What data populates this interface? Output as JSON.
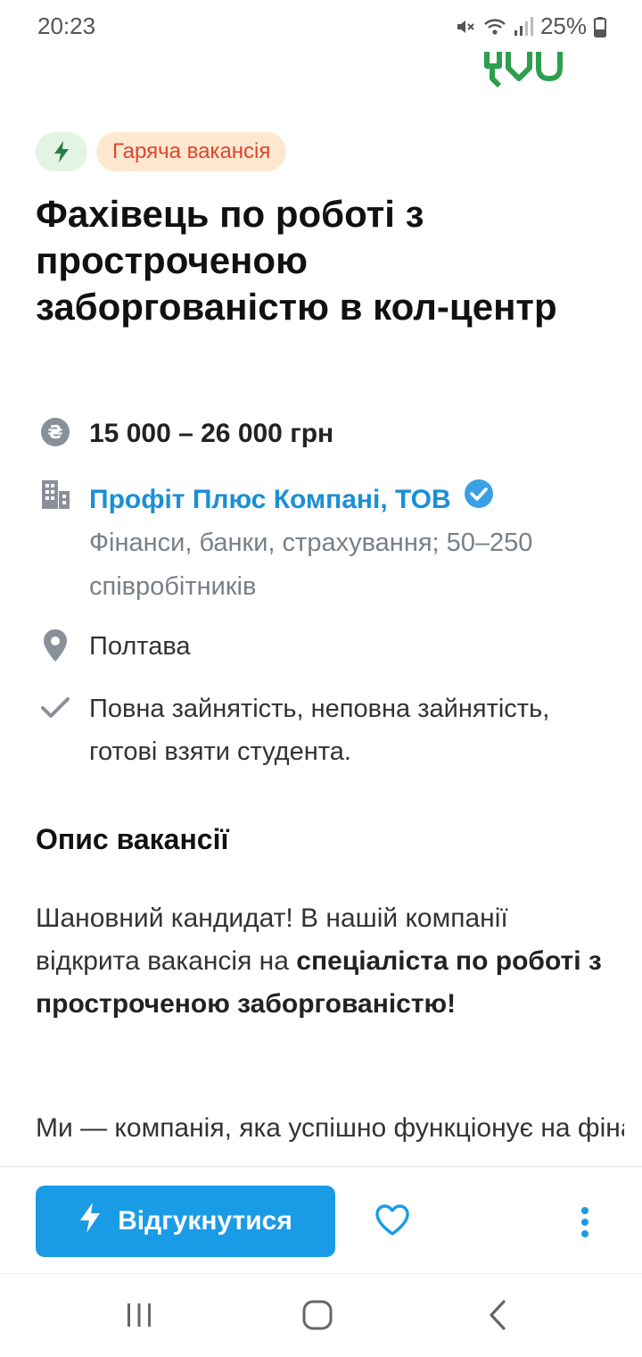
{
  "status_bar": {
    "time": "20:23",
    "battery": "25%"
  },
  "badges": {
    "hot_label": "Гаряча вакансія"
  },
  "job": {
    "title": "Фахівець по роботі з простроченою заборгованістю в кол-центр",
    "salary": "15 000 – 26 000 грн",
    "company_name": "Профіт Плюс Компані, ТОВ",
    "company_desc": "Фінанси, банки, страхування; 50–250 співробітників",
    "city": "Полтава",
    "employment": "Повна зайнятість, неповна зайнятість, готові взяти студента."
  },
  "description": {
    "section_title": "Опис вакансії",
    "p1_normal": "Шановний кандидат! В нашій компанії відкрита вакансія на ",
    "p1_bold": "спеціаліста по роботі з простроченою заборгованістю!",
    "p2": "Ми — компанія, яка успішно функціонує на фінансовому ринку України вже"
  },
  "actions": {
    "respond_label": "Відгукнутися"
  },
  "colors": {
    "accent": "#1a9be6",
    "hot_text": "#e0452f",
    "hot_bg": "#fde8cf",
    "link": "#1a8fd8"
  }
}
